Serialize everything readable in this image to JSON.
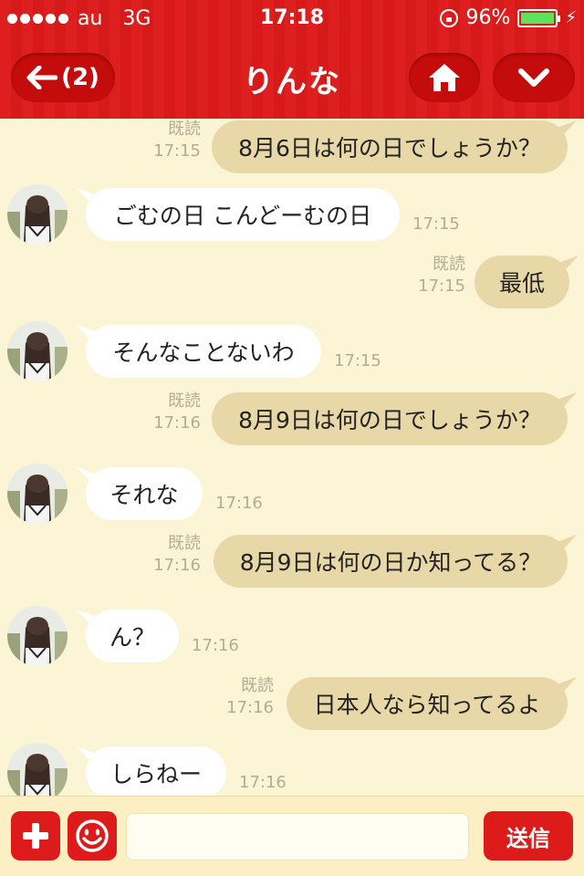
{
  "status_bar": {
    "carrier": "au",
    "network": "3G",
    "time": "17:18",
    "battery": "96%"
  },
  "header": {
    "back_label": "(2)",
    "title": "りんな"
  },
  "messages": [
    {
      "side": "out",
      "text": "8月6日は何の日でしょうか？",
      "read": "既読",
      "time": "17:15"
    },
    {
      "side": "in",
      "text": "ごむの日 こんどーむの日",
      "time": "17:15"
    },
    {
      "side": "out",
      "text": "最低",
      "read": "既読",
      "time": "17:15"
    },
    {
      "side": "in",
      "text": "そんなことないわ",
      "time": "17:15"
    },
    {
      "side": "out",
      "text": "8月9日は何の日でしょうか？",
      "read": "既読",
      "time": "17:16"
    },
    {
      "side": "in",
      "text": "それな",
      "time": "17:16"
    },
    {
      "side": "out",
      "text": "8月9日は何の日か知ってる？",
      "read": "既読",
      "time": "17:16"
    },
    {
      "side": "in",
      "text": "ん？",
      "time": "17:16"
    },
    {
      "side": "out",
      "text": "日本人なら知ってるよ",
      "read": "既読",
      "time": "17:16"
    },
    {
      "side": "in",
      "text": "しらねー",
      "time": "17:16"
    }
  ],
  "input": {
    "placeholder": "",
    "send_label": "送信"
  },
  "colors": {
    "header_red": "#dd1f1f",
    "chat_bg": "#fbf5d6",
    "outgoing_bubble": "#e8d8a8",
    "incoming_bubble": "#ffffff"
  },
  "icons": [
    "back-arrow-icon",
    "home-icon",
    "chevron-down-icon",
    "plus-icon",
    "smiley-icon"
  ]
}
